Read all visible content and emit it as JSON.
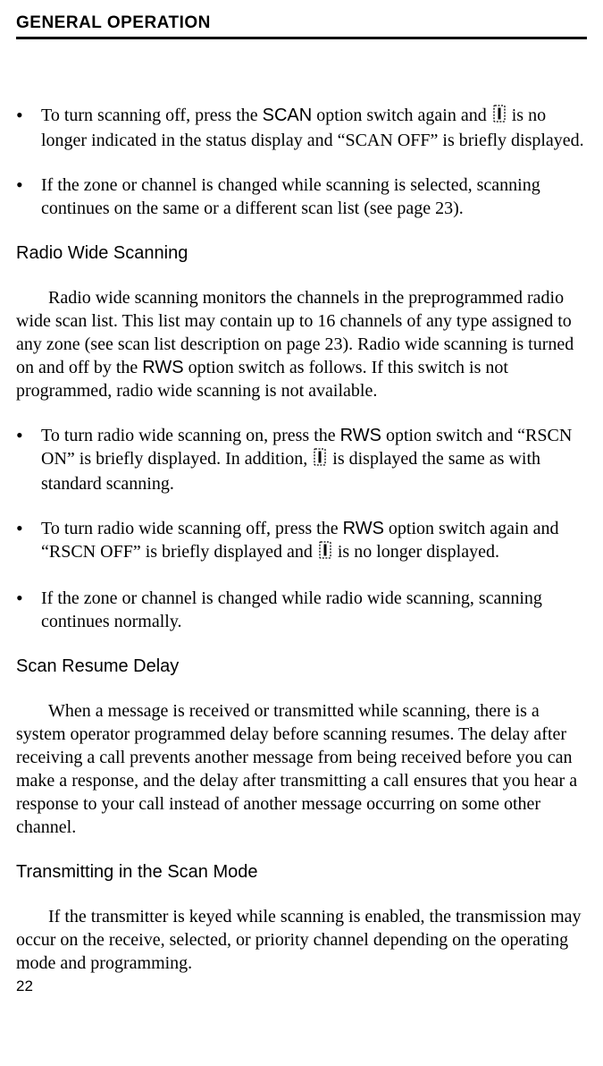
{
  "header": {
    "title": "GENERAL OPERATION"
  },
  "sections": {
    "scan_off_bullets": [
      {
        "pre": "To turn scanning off, press the ",
        "key": "SCAN",
        "mid": " option switch again and ",
        "post": " is no longer indicated in the status display and “SCAN OFF” is briefly displayed."
      },
      {
        "text": "If the zone or channel is changed while scanning is selected, scanning continues on the same or a different scan list (see page 23)."
      }
    ],
    "radio_wide": {
      "title": "Radio Wide Scanning",
      "para_pre": "Radio wide scanning monitors the channels in the preprogrammed radio wide scan list. This list may contain up to 16 channels of any type assigned to any zone (see scan list description on page 23). Radio wide scanning is turned on and off by the ",
      "para_key": "RWS",
      "para_post": " option switch as follows. If this switch is not programmed, radio wide scanning is not available.",
      "bullets": [
        {
          "pre": "To turn radio wide scanning on, press the ",
          "key": "RWS",
          "mid": " option switch and “RSCN ON” is briefly displayed. In addition, ",
          "post": " is displayed the same as with standard scanning."
        },
        {
          "pre": "To turn radio wide scanning off, press the ",
          "key": "RWS",
          "mid": " option switch again and “RSCN OFF” is briefly displayed and ",
          "post": " is no longer displayed."
        },
        {
          "text": "If the zone or channel is changed while radio wide scanning, scanning continues normally."
        }
      ]
    },
    "scan_resume": {
      "title": "Scan Resume Delay",
      "para": "When a message is received or transmitted while scanning, there is a system operator programmed delay before scanning resumes. The delay after receiving a call prevents another message from being received before you can make a response, and the delay after transmitting a call ensures that you hear a response to your call instead of another message occurring on some other channel."
    },
    "transmit_scan": {
      "title": "Transmitting in the Scan Mode",
      "para": "If the transmitter is keyed while scanning is enabled, the transmission may occur on the receive, selected, or priority channel depending on the operating mode and programming."
    }
  },
  "page_number": "22"
}
